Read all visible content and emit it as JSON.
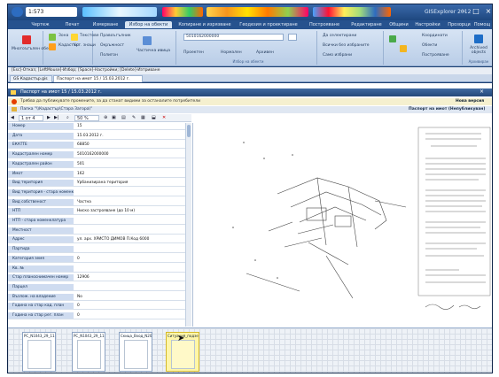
{
  "window": {
    "title": "GISExplorer 2012",
    "quick_input": "1:573",
    "controls": [
      "–",
      "□",
      "×"
    ]
  },
  "menu": [
    "Чертеж",
    "Печат",
    "Измерване",
    "Избор на обекти",
    "Копиране и изрязване",
    "Геодезия и проектиране",
    "Построяване",
    "Редактиране",
    "Общини",
    "Настройки",
    "Прозорци",
    "Помощ"
  ],
  "ribbon": {
    "groups": [
      {
        "label": "",
        "items": [
          "Многоъгълен обект",
          "Зона",
          "Кадастър",
          "Текстове",
          "Уст. знаци"
        ]
      },
      {
        "label": "",
        "items": [
          "Правоъгълник",
          "Окръжност",
          "Полигон",
          "Частична ивица"
        ]
      },
      {
        "label": "Избор на обекти",
        "items": [
          "5010162000000",
          "Проектен",
          "Нормален",
          "Архивен"
        ]
      },
      {
        "label": "",
        "items": [
          "Да селектирани",
          "Всички без избраните",
          "Само избрани"
        ]
      },
      {
        "label": "",
        "items": [
          "Координати",
          "Обекти",
          "Построяване"
        ]
      },
      {
        "label": "Архивиран",
        "items": [
          "Archived objects"
        ]
      }
    ]
  },
  "hint_bar": "[Esc]-Отказ; [LeftMouse]-Избор; [Space]-Настройки; [Delete]-Изтриване",
  "tabs": [
    "GS Кадастър.gis",
    "Паспорт на имот 15 / 15.03.2012 г."
  ],
  "document": {
    "title": "Паспорт на имот 15 / 15.03.2012 г.",
    "warning": "Трябва да публикувате промените, за да станат видими за останалите потребители",
    "folder": "Папка \"\\\\Кадастър\\Стара Загора\\\"",
    "right_title": "Паспорт на имот (Непубликуван)",
    "new_version": "Нова версия",
    "pager": "1 от 4",
    "zoom": "50 %"
  },
  "properties": [
    [
      "Номер",
      "15"
    ],
    [
      "Дата",
      "15.03.2012 г."
    ],
    [
      "ЕКАТТЕ",
      "68850"
    ],
    [
      "Кадастрален номер",
      "5010162000000"
    ],
    [
      "Кадастрален район",
      "501"
    ],
    [
      "Имот",
      "162"
    ],
    [
      "Вид територия",
      "Урбанизирана територия"
    ],
    [
      "Вид територия - стара номенклатура",
      ""
    ],
    [
      "Вид собственост",
      "Частна"
    ],
    [
      "НТП",
      "Ниско застрояване (до 10 м)"
    ],
    [
      "НТП - стара номенклатура",
      ""
    ],
    [
      "Местност",
      ""
    ],
    [
      "Адрес",
      "ул. арх. ХРИСТО ДИМОВ П.Код 6000"
    ],
    [
      "Партида",
      ""
    ],
    [
      "Категория земя",
      "0"
    ],
    [
      "Кв. №",
      ""
    ],
    [
      "Стар планоснимачен номер",
      "12906"
    ],
    [
      "Парцел",
      ""
    ],
    [
      "Възлож. на владение",
      "No"
    ],
    [
      "Година на стар кад. план",
      "0"
    ],
    [
      "Година на стар рег. план",
      "0"
    ]
  ],
  "thumbnails": [
    "РС_N1043_29_11...",
    "РС_N1043_29_11...",
    "Скица_Вход_N20...",
    "Ситуация_подзе..."
  ]
}
